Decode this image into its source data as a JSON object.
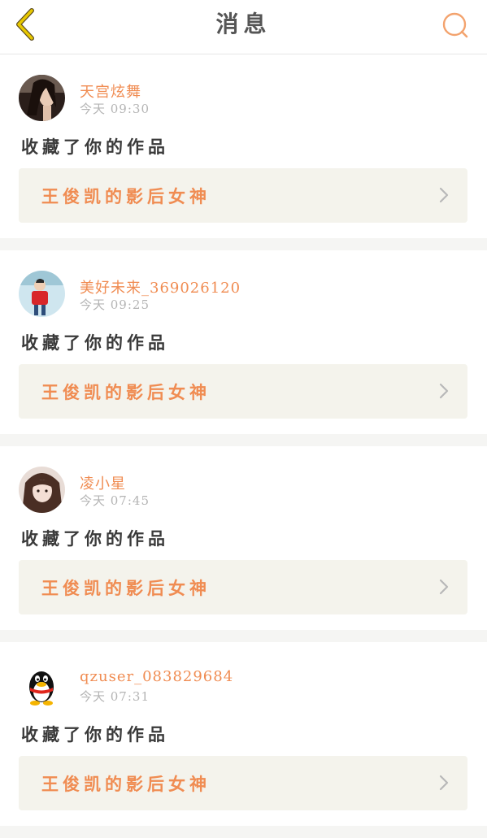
{
  "header": {
    "title": "消息",
    "back_icon": "chevron-left-icon",
    "search_icon": "search-icon",
    "accent_color": "#f08c52",
    "back_color": "#d4b800"
  },
  "notifications": [
    {
      "username": "天宫炫舞",
      "time": "今天  09:30",
      "action": "收藏了你的作品",
      "work_title": "王俊凯的影后女神",
      "avatar": "female-portrait-avatar"
    },
    {
      "username": "美好未来_369026120",
      "time": "今天  09:25",
      "action": "收藏了你的作品",
      "work_title": "王俊凯的影后女神",
      "avatar": "child-red-sweater-avatar"
    },
    {
      "username": "凌小星",
      "time": "今天  07:45",
      "action": "收藏了你的作品",
      "work_title": "王俊凯的影后女神",
      "avatar": "girl-portrait-avatar"
    },
    {
      "username": "qzuser_083829684",
      "time": "今天  07:31",
      "action": "收藏了你的作品",
      "work_title": "王俊凯的影后女神",
      "avatar": "qq-penguin-avatar"
    }
  ]
}
